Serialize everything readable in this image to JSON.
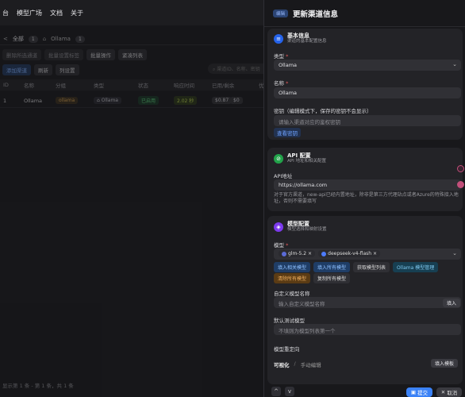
{
  "topnav": {
    "items": [
      "台",
      "模型广场",
      "文档",
      "关于"
    ]
  },
  "crumbs": {
    "back": "<",
    "all_label": "全部",
    "all_count": "1",
    "ollama_label": "Ollama",
    "ollama_count": "1"
  },
  "toolbar1": {
    "delete_selected": "删除所选通道",
    "batch_tag": "批量设置标签",
    "batch_ops": "批量操作",
    "compact": "紧凑列表"
  },
  "toolbar2": {
    "add": "添加渠道",
    "refresh": "刷新",
    "columns": "列设置"
  },
  "search": {
    "placeholder": "渠道ID、名称、密钥"
  },
  "table": {
    "headers": [
      "ID",
      "名称",
      "分组",
      "类型",
      "状态",
      "响应时间",
      "已用/剩余",
      "优"
    ],
    "row": {
      "id": "1",
      "name": "Ollama",
      "group": "ollama",
      "type": "Ollama",
      "status": "已启用",
      "resp": "2.02 秒",
      "used": "$0.87",
      "remain": "$0"
    }
  },
  "footer_info": "显示第 1 条 - 第 1 条，共 1 条",
  "panel": {
    "badge": "编辑",
    "title": "更新渠道信息",
    "basic": {
      "title": "基本信息",
      "subtitle": "渠道的基本配置信息",
      "type_label": "类型",
      "type_value": "Ollama",
      "name_label": "名称",
      "name_value": "Ollama",
      "key_label": "密钥（编辑模式下，保存的密钥不会显示）",
      "key_placeholder": "请输入渠道对应的鉴权密钥",
      "view_key": "查看密钥"
    },
    "api": {
      "title": "API 配置",
      "subtitle": "API 地址和相关配置",
      "addr_label": "API地址",
      "addr_value": "https://ollama.com",
      "hint": "对于官方渠道，new-api已经内置地址，除非是第三方代理站点或者Azure的特殊接入地址，否则不需要填写"
    },
    "model": {
      "title": "模型配置",
      "subtitle": "模型选择和映射设置",
      "models_label": "模型",
      "tags": [
        "glm-5.2",
        "deepseek-v4-flash"
      ],
      "btn_fill_related": "填入相关模型",
      "btn_fill_all": "填入所有模型",
      "btn_fetch": "获取模型列表",
      "btn_manage": "Ollama 模型管理",
      "btn_clear": "清除所有模型",
      "btn_copy": "复制所有模型",
      "custom_label": "自定义模型名称",
      "custom_placeholder": "输入自定义模型名称",
      "custom_fill": "填入",
      "test_label": "默认测试模型",
      "test_placeholder": "不填则为模型列表第一个",
      "redirect_label": "模型重定向",
      "visual": "可视化",
      "sep": "/",
      "manual": "手动编辑",
      "template": "填入模板"
    },
    "nav_up": "^",
    "nav_down": "v",
    "submit": "提交",
    "cancel": "取消"
  },
  "colors": {
    "accent": "#3b82f6",
    "basic_icon": "#2563eb",
    "api_icon": "#22a34a",
    "model_icon": "#7c3aed"
  }
}
